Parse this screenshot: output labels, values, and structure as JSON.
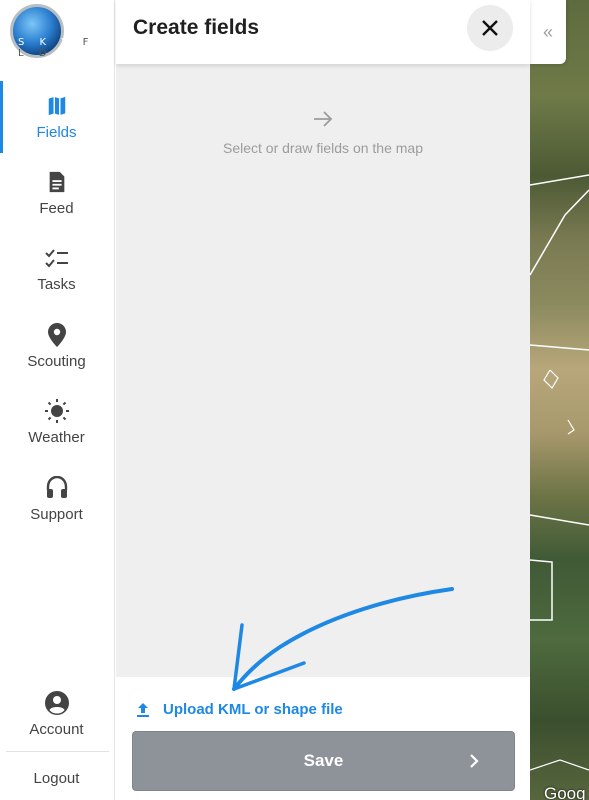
{
  "brand": {
    "logo_text_left": "S K Y",
    "logo_text_right": "F L D"
  },
  "sidebar": {
    "items": [
      {
        "label": "Fields",
        "icon": "map-icon",
        "active": true
      },
      {
        "label": "Feed",
        "icon": "document-icon"
      },
      {
        "label": "Tasks",
        "icon": "checklist-icon"
      },
      {
        "label": "Scouting",
        "icon": "location-pin-icon"
      },
      {
        "label": "Weather",
        "icon": "sun-icon"
      },
      {
        "label": "Support",
        "icon": "headset-icon"
      }
    ],
    "account_label": "Account",
    "logout_label": "Logout"
  },
  "panel": {
    "title": "Create fields",
    "hint": "Select or draw fields on the map",
    "upload_label": "Upload KML or shape file",
    "save_label": "Save"
  },
  "map": {
    "attribution": "Goog"
  },
  "colors": {
    "accent": "#1e88e5",
    "save_disabled": "#8e939a",
    "panel_bg": "#efefef"
  }
}
